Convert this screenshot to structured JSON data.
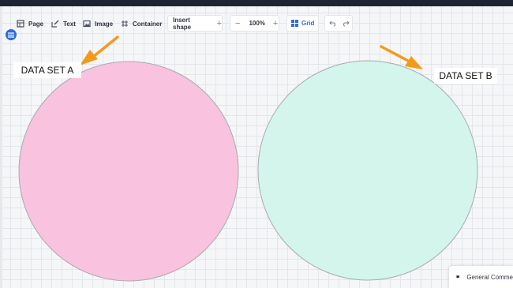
{
  "toolbar": {
    "page_label": "Page",
    "text_label": "Text",
    "image_label": "Image",
    "container_label": "Container",
    "insert_shape_label": "Insert shape",
    "zoom_value": "100%",
    "grid_label": "Grid"
  },
  "canvas": {
    "label_a": "DATA SET A",
    "label_b": "DATA SET B",
    "circle_a_color": "#f9c2df",
    "circle_b_color": "#d3f5ec",
    "arrow_color": "#f39a1d"
  },
  "comments": {
    "label": "General Comme"
  },
  "icons": [
    "page-icon",
    "text-edit-icon",
    "image-icon",
    "container-icon",
    "plus-icon",
    "minus-icon",
    "grid-icon",
    "undo-icon",
    "redo-icon",
    "menu-icon",
    "comment-icon"
  ]
}
